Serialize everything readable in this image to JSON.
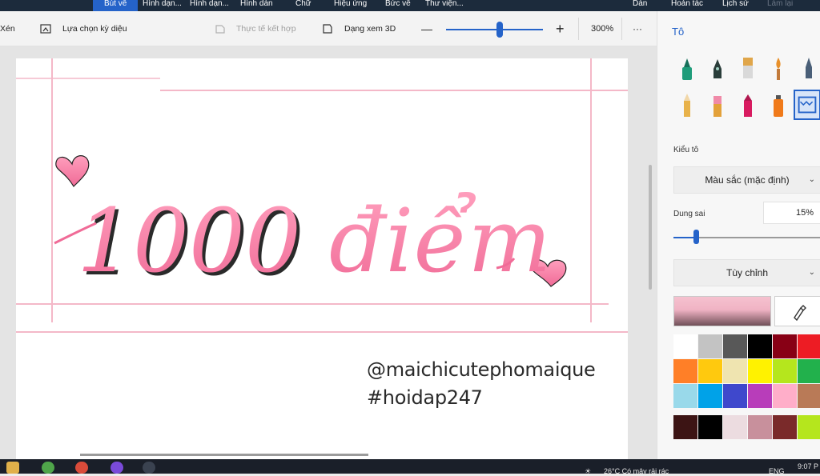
{
  "menubar": {
    "items": [
      "Bút vẽ",
      "Hình dạn...",
      "Hình dạn...",
      "Hình dán",
      "Chữ",
      "Hiệu ứng",
      "Bức vẽ",
      "Thư viện..."
    ],
    "right": [
      "Dán",
      "Hoàn tác",
      "Lịch sử",
      "Làm lại"
    ]
  },
  "toolbar": {
    "crop_label": "Xén",
    "magic_select_label": "Lựa chọn kỳ diệu",
    "mixed_reality_label": "Thực tế kết hợp",
    "view3d_label": "Dạng xem 3D",
    "zoom_level": "300%",
    "zoom_fraction": 0.55,
    "more_label": "···"
  },
  "canvas": {
    "headline": "1000 điểm",
    "handle": "@maichicutephomaique",
    "hashtag": "#hoidap247"
  },
  "panel": {
    "title": "Tô",
    "fill_style_label": "Kiểu tô",
    "fill_style_value": "Màu sắc (mặc định)",
    "tolerance_label": "Dung sai",
    "tolerance_value": "15%",
    "tolerance_fraction": 0.15,
    "custom_label": "Tùy chỉnh",
    "current_color": "#f5c1cf",
    "colors": [
      "#ffffff",
      "#c3c3c3",
      "#585858",
      "#000000",
      "#880015",
      "#ed1c24",
      "#ff7f27",
      "#ffc90e",
      "#efe4b0",
      "#fff200",
      "#b5e61d",
      "#22b14c",
      "#99d9ea",
      "#00a2e8",
      "#3f48cc",
      "#b83dba",
      "#ffaec9",
      "#b97a57",
      "#3c1414",
      "#000000",
      "#ecdce0",
      "#c8909c",
      "#7a2a2a",
      "#b5e61d"
    ]
  },
  "taskbar": {
    "weather": "26°C  Có mây rải rác",
    "lang": "ENG",
    "time": "9:07 P"
  }
}
